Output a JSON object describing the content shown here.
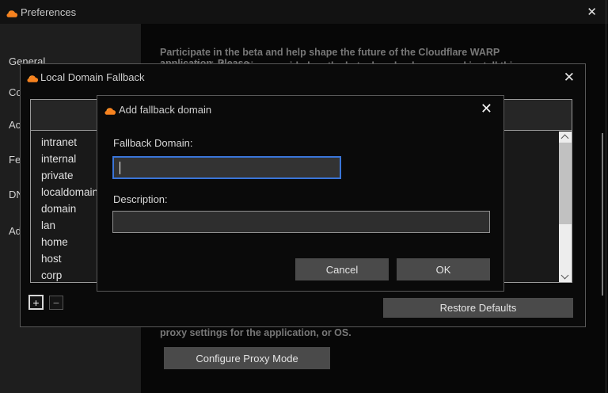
{
  "window": {
    "title": "Preferences"
  },
  "icons": {
    "close_glyph": "✕",
    "app_icon": "cloudflare-cloud"
  },
  "sidebar": {
    "items": [
      {
        "label": "General"
      },
      {
        "label": "Connection"
      },
      {
        "label": "Account"
      },
      {
        "label": "Feedback"
      },
      {
        "label": "DNS"
      },
      {
        "label": "Advanced"
      }
    ]
  },
  "content": {
    "beta_text_line1": "Participate in the beta and help shape the future of the Cloudflare WARP application. Please",
    "beta_text_line2_partial": "review the information provided on the beta downloads page and install this application as usual.",
    "proxy_text": "proxy settings for the application, or OS.",
    "configure_proxy_button": "Configure Proxy Mode"
  },
  "fallback_dialog": {
    "title": "Local Domain Fallback",
    "domains": [
      "intranet",
      "internal",
      "private",
      "localdomain",
      "domain",
      "lan",
      "home",
      "host",
      "corp"
    ],
    "add_button": "+",
    "remove_button": "−",
    "restore_defaults_button": "Restore Defaults"
  },
  "add_dialog": {
    "title": "Add fallback domain",
    "fallback_domain_label": "Fallback Domain:",
    "fallback_domain_value": "",
    "description_label": "Description:",
    "description_value": "",
    "cancel_button": "Cancel",
    "ok_button": "OK"
  },
  "colors": {
    "brand_orange": "#f6821f",
    "focus_blue": "#3a75d8",
    "button_gray": "#4a4a4a"
  }
}
